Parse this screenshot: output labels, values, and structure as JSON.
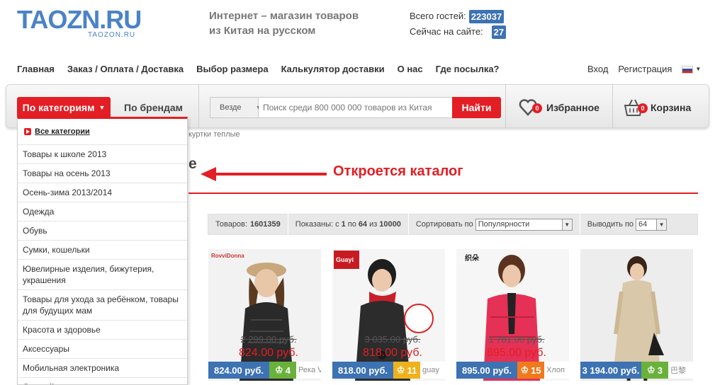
{
  "header": {
    "logo_text": "TAOZN.RU",
    "logo_sub": "TAOZON.RU",
    "slogan_line1": "Интернет – магазин товаров",
    "slogan_line2": "из Китая на русском",
    "stats": [
      {
        "label": "Всего гостей:",
        "value": "223037"
      },
      {
        "label": "Сейчас на сайте:",
        "value": "27"
      }
    ]
  },
  "topnav": [
    "Главная",
    "Заказ / Оплата / Доставка",
    "Выбор размера",
    "Калькулятор доставки",
    "О нас",
    "Где посылка?"
  ],
  "usernav": {
    "login": "Вход",
    "register": "Регистрация"
  },
  "toolbar": {
    "categories_label": "По категориям",
    "brands_label": "По брендам",
    "scope": "Везде",
    "search_placeholder": "Поиск среди 800 000 000 товаров из Китая",
    "search_button": "Найти",
    "favorites": {
      "label": "Избранное",
      "count": "0"
    },
    "cart": {
      "label": "Корзина",
      "count": "0"
    }
  },
  "breadcrumb": "куртки теплые",
  "heading_fragment": "е",
  "annotation": "Откроется каталог",
  "menu": {
    "all": "Все категории",
    "items": [
      "Товары к школе 2013",
      "Товары на осень 2013",
      "Осень-зима 2013/2014",
      "Одежда",
      "Обувь",
      "Сумки, кошельки",
      "Ювелирные изделия, бижутерия, украшения",
      "Товары для ухода за ребёнком, товары для будущих мам",
      "Красота и здоровье",
      "Аксессуары",
      "Мобильная электроника",
      "Детский мир"
    ]
  },
  "sortbar": {
    "goods_label": "Товаров:",
    "goods_count": "1601359",
    "shown_prefix": "Показаны: с",
    "shown_from": "1",
    "shown_to_label": "по",
    "shown_to": "64",
    "shown_of_label": "из",
    "shown_total": "10000",
    "sort_label": "Сортировать по",
    "sort_value": "Популярности",
    "show_label": "Выводить по",
    "show_value": "64"
  },
  "products": [
    {
      "old_price": "2 299.00 руб.",
      "new_price": "824.00 руб.",
      "price": "824.00 руб.",
      "rating": "4",
      "rating_color": "#6ab13c",
      "seller": "Река V",
      "brand_text": "RovviDonna"
    },
    {
      "old_price": "3 035.00 руб.",
      "new_price": "818.00 руб.",
      "price": "818.00 руб.",
      "rating": "11",
      "rating_color": "#f0b21b",
      "seller": "guay",
      "brand_text": "Guayi"
    },
    {
      "old_price": "1 781.00 руб.",
      "new_price": "895.00 руб.",
      "price": "895.00 руб.",
      "rating": "15",
      "rating_color": "#f07a1b",
      "seller": "Хлоп",
      "brand_text": "织朵"
    },
    {
      "old_price": "",
      "new_price": "",
      "price": "3 194.00 руб.",
      "rating": "3",
      "rating_color": "#6ab13c",
      "seller": "巴黎",
      "brand_text": ""
    }
  ]
}
